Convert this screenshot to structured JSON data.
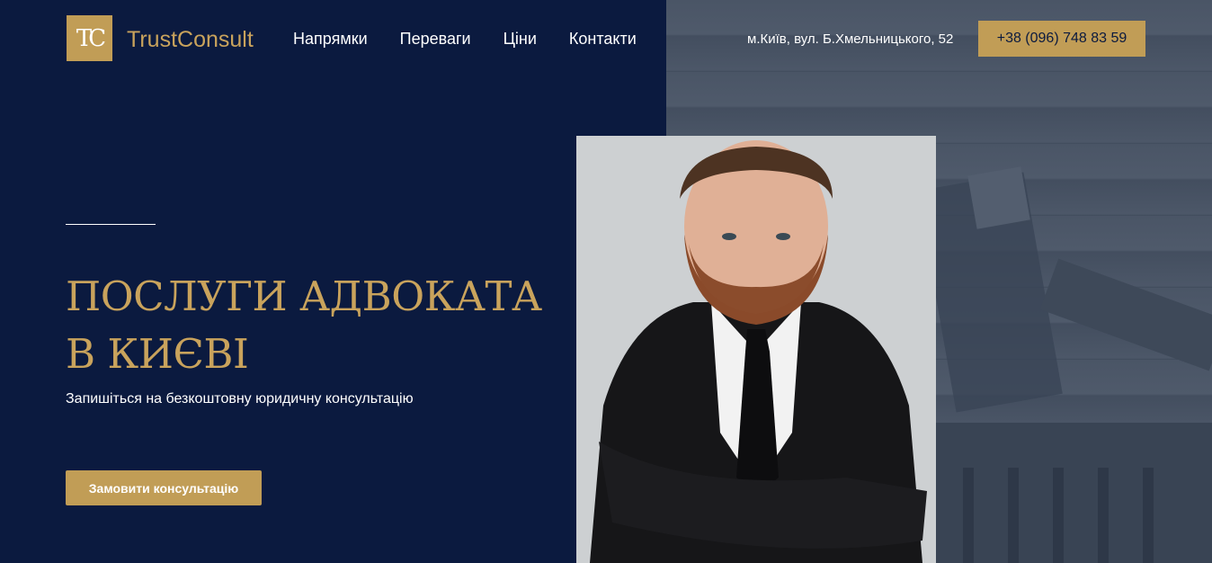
{
  "header": {
    "logo_text": "TC",
    "brand": "TrustConsult",
    "nav": [
      "Напрямки",
      "Переваги",
      "Ціни",
      "Контакти"
    ],
    "address": "м.Київ, вул. Б.Хмельницького, 52",
    "phone": "+38 (096) 748 83 59"
  },
  "hero": {
    "title_line1": "ПОСЛУГИ АДВОКАТА",
    "title_line2": "В КИЄВІ",
    "subtitle": "Запишіться на безкоштовну юридичну консультацію",
    "cta_label": "Замовити консультацію"
  },
  "colors": {
    "navy": "#0b1a3f",
    "gold": "#c19d56",
    "slate": "#4a5566"
  },
  "icons": {
    "logo": "tc-monogram-icon"
  }
}
